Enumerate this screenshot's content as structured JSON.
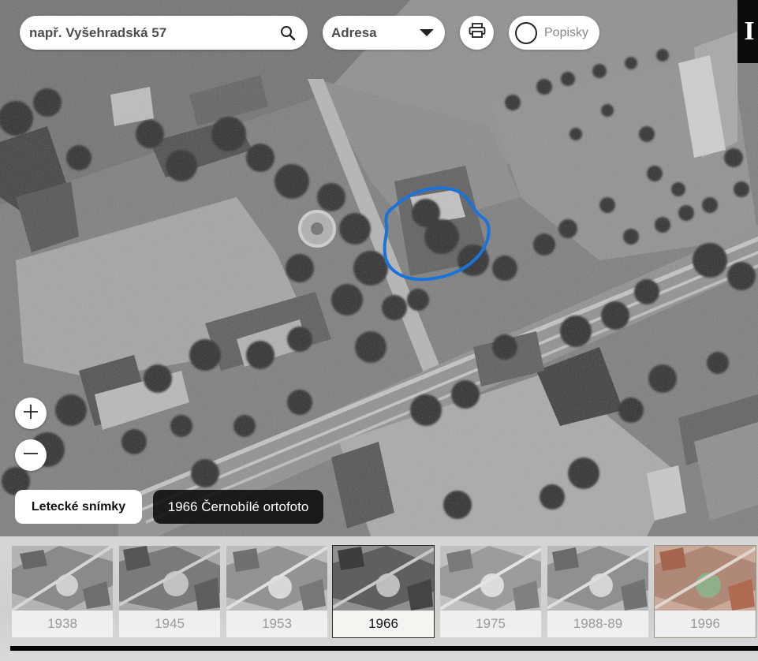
{
  "search": {
    "placeholder": "např. Vyšehradská 57"
  },
  "search_type": {
    "selected": "Adresa"
  },
  "labels_toggle": {
    "label": "Popisky",
    "checked": false
  },
  "info_button": {
    "label": "I"
  },
  "layer_button": {
    "label": "Letecké snímky"
  },
  "caption": {
    "text": "1966 Černobílé ortofoto"
  },
  "map": {
    "highlight_color": "#1a73d9"
  },
  "timeline": {
    "items": [
      {
        "year": "1938",
        "active": false
      },
      {
        "year": "1945",
        "active": false
      },
      {
        "year": "1953",
        "active": false
      },
      {
        "year": "1966",
        "active": true
      },
      {
        "year": "1975",
        "active": false
      },
      {
        "year": "1988-89",
        "active": false
      },
      {
        "year": "1996",
        "active": false
      }
    ]
  },
  "icons": {
    "search": "search-icon",
    "dropdown": "chevron-down-icon",
    "print": "printer-icon",
    "zoom_in": "plus-icon",
    "zoom_out": "minus-icon"
  }
}
